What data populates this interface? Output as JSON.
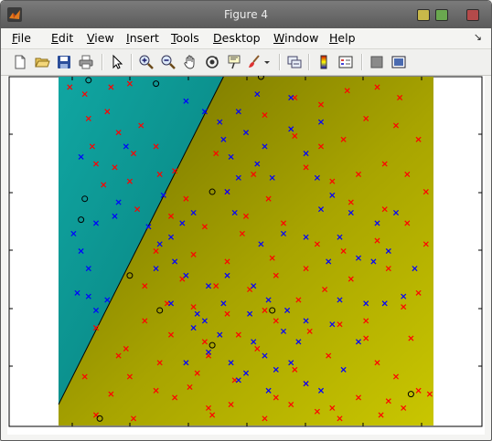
{
  "window": {
    "title": "Figure 4",
    "buttons": [
      "minimize",
      "maximize",
      "close"
    ]
  },
  "menu": {
    "items": [
      {
        "label": "File",
        "mnemonic": "F",
        "rest": "ile"
      },
      {
        "label": "Edit",
        "mnemonic": "E",
        "rest": "dit"
      },
      {
        "label": "View",
        "mnemonic": "V",
        "rest": "iew"
      },
      {
        "label": "Insert",
        "mnemonic": "I",
        "rest": "nsert"
      },
      {
        "label": "Tools",
        "mnemonic": "T",
        "rest": "ools"
      },
      {
        "label": "Desktop",
        "mnemonic": "D",
        "rest": "esktop"
      },
      {
        "label": "Window",
        "mnemonic": "W",
        "rest": "indow"
      },
      {
        "label": "Help",
        "mnemonic": "H",
        "rest": "elp"
      }
    ],
    "dock_icon": "dock-arrow-icon"
  },
  "toolbar": {
    "icons": [
      "new-figure-icon",
      "open-file-icon",
      "save-figure-icon",
      "print-figure-icon",
      "edit-plot-arrow-icon",
      "zoom-in-icon",
      "zoom-out-icon",
      "pan-hand-icon",
      "rotate-3d-icon",
      "data-cursor-icon",
      "brush-icon",
      "brush-dropdown-icon",
      "link-plot-icon",
      "insert-colorbar-icon",
      "insert-legend-icon",
      "hide-plot-tools-icon",
      "show-plot-tools-icon"
    ]
  },
  "colors": {
    "region_class_a": "#0d9e9a",
    "region_class_b": "#a8a400",
    "class_red": "#ff0000",
    "class_blue": "#0000ff",
    "boundary": "#000000"
  },
  "chart_data": {
    "type": "scatter",
    "title": "",
    "xlabel": "",
    "ylabel": "",
    "xlim": [
      0,
      1
    ],
    "ylim": [
      0,
      1
    ],
    "grid": false,
    "tick_labels_shown": false,
    "background": "decision regions: teal (upper-left, class blue) / olive-yellow gradient (lower-right, class red)",
    "decision_boundary": [
      [
        0,
        0.06
      ],
      [
        0.44,
        1.0
      ]
    ],
    "series": [
      {
        "color": "red",
        "marker": "x",
        "points": [
          [
            0.03,
            0.97
          ],
          [
            0.07,
            0.95
          ],
          [
            0.14,
            0.97
          ],
          [
            0.19,
            0.98
          ],
          [
            0.08,
            0.88
          ],
          [
            0.13,
            0.9
          ],
          [
            0.09,
            0.8
          ],
          [
            0.16,
            0.84
          ],
          [
            0.22,
            0.86
          ],
          [
            0.1,
            0.75
          ],
          [
            0.15,
            0.74
          ],
          [
            0.2,
            0.78
          ],
          [
            0.26,
            0.8
          ],
          [
            0.12,
            0.69
          ],
          [
            0.19,
            0.7
          ],
          [
            0.27,
            0.72
          ],
          [
            0.21,
            0.62
          ],
          [
            0.3,
            0.6
          ],
          [
            0.39,
            0.57
          ],
          [
            0.49,
            0.55
          ],
          [
            0.26,
            0.5
          ],
          [
            0.36,
            0.49
          ],
          [
            0.45,
            0.47
          ],
          [
            0.6,
            0.58
          ],
          [
            0.33,
            0.42
          ],
          [
            0.42,
            0.4
          ],
          [
            0.51,
            0.39
          ],
          [
            0.58,
            0.43
          ],
          [
            0.66,
            0.45
          ],
          [
            0.36,
            0.34
          ],
          [
            0.45,
            0.32
          ],
          [
            0.55,
            0.33
          ],
          [
            0.64,
            0.36
          ],
          [
            0.71,
            0.39
          ],
          [
            0.78,
            0.42
          ],
          [
            0.88,
            0.45
          ],
          [
            0.23,
            0.3
          ],
          [
            0.3,
            0.26
          ],
          [
            0.39,
            0.24
          ],
          [
            0.53,
            0.22
          ],
          [
            0.67,
            0.27
          ],
          [
            0.75,
            0.29
          ],
          [
            0.82,
            0.3
          ],
          [
            0.92,
            0.34
          ],
          [
            0.96,
            0.38
          ],
          [
            0.1,
            0.28
          ],
          [
            0.16,
            0.2
          ],
          [
            0.27,
            0.18
          ],
          [
            0.37,
            0.15
          ],
          [
            0.47,
            0.13
          ],
          [
            0.63,
            0.16
          ],
          [
            0.72,
            0.2
          ],
          [
            0.85,
            0.18
          ],
          [
            0.94,
            0.25
          ],
          [
            0.07,
            0.14
          ],
          [
            0.14,
            0.09
          ],
          [
            0.26,
            0.1
          ],
          [
            0.31,
            0.08
          ],
          [
            0.46,
            0.06
          ],
          [
            0.58,
            0.08
          ],
          [
            0.62,
            0.06
          ],
          [
            0.73,
            0.05
          ],
          [
            0.8,
            0.08
          ],
          [
            0.88,
            0.07
          ],
          [
            0.96,
            0.1
          ],
          [
            0.99,
            0.09
          ],
          [
            0.1,
            0.03
          ],
          [
            0.2,
            0.02
          ],
          [
            0.41,
            0.03
          ],
          [
            0.55,
            0.02
          ],
          [
            0.75,
            0.02
          ],
          [
            0.86,
            0.03
          ],
          [
            0.55,
            0.89
          ],
          [
            0.63,
            0.94
          ],
          [
            0.7,
            0.92
          ],
          [
            0.77,
            0.96
          ],
          [
            0.85,
            0.97
          ],
          [
            0.91,
            0.94
          ],
          [
            0.63,
            0.83
          ],
          [
            0.7,
            0.8
          ],
          [
            0.76,
            0.82
          ],
          [
            0.82,
            0.88
          ],
          [
            0.9,
            0.86
          ],
          [
            0.96,
            0.82
          ],
          [
            0.66,
            0.74
          ],
          [
            0.73,
            0.7
          ],
          [
            0.8,
            0.72
          ],
          [
            0.87,
            0.75
          ],
          [
            0.93,
            0.72
          ],
          [
            0.98,
            0.67
          ],
          [
            0.78,
            0.64
          ],
          [
            0.87,
            0.62
          ],
          [
            0.93,
            0.58
          ],
          [
            0.98,
            0.52
          ],
          [
            0.42,
            0.78
          ],
          [
            0.52,
            0.72
          ],
          [
            0.45,
            0.67
          ],
          [
            0.56,
            0.65
          ],
          [
            0.5,
            0.6
          ],
          [
            0.34,
            0.65
          ],
          [
            0.31,
            0.73
          ],
          [
            0.69,
            0.52
          ],
          [
            0.76,
            0.5
          ],
          [
            0.85,
            0.53
          ],
          [
            0.57,
            0.48
          ],
          [
            0.23,
            0.4
          ],
          [
            0.29,
            0.35
          ],
          [
            0.18,
            0.22
          ],
          [
            0.19,
            0.14
          ],
          [
            0.4,
            0.2
          ],
          [
            0.48,
            0.26
          ],
          [
            0.58,
            0.3
          ],
          [
            0.82,
            0.25
          ],
          [
            0.9,
            0.14
          ],
          [
            0.66,
            0.12
          ],
          [
            0.35,
            0.11
          ],
          [
            0.4,
            0.05
          ],
          [
            0.69,
            0.04
          ],
          [
            0.92,
            0.05
          ]
        ]
      },
      {
        "color": "blue",
        "marker": "x",
        "points": [
          [
            0.06,
            0.77
          ],
          [
            0.1,
            0.58
          ],
          [
            0.04,
            0.55
          ],
          [
            0.06,
            0.5
          ],
          [
            0.08,
            0.45
          ],
          [
            0.05,
            0.38
          ],
          [
            0.08,
            0.37
          ],
          [
            0.13,
            0.36
          ],
          [
            0.1,
            0.33
          ],
          [
            0.16,
            0.64
          ],
          [
            0.18,
            0.8
          ],
          [
            0.15,
            0.6
          ],
          [
            0.34,
            0.93
          ],
          [
            0.39,
            0.9
          ],
          [
            0.43,
            0.87
          ],
          [
            0.48,
            0.9
          ],
          [
            0.53,
            0.95
          ],
          [
            0.62,
            0.94
          ],
          [
            0.44,
            0.82
          ],
          [
            0.5,
            0.84
          ],
          [
            0.55,
            0.8
          ],
          [
            0.46,
            0.77
          ],
          [
            0.53,
            0.75
          ],
          [
            0.57,
            0.71
          ],
          [
            0.48,
            0.71
          ],
          [
            0.45,
            0.67
          ],
          [
            0.62,
            0.85
          ],
          [
            0.7,
            0.87
          ],
          [
            0.66,
            0.78
          ],
          [
            0.73,
            0.66
          ],
          [
            0.7,
            0.62
          ],
          [
            0.78,
            0.61
          ],
          [
            0.85,
            0.58
          ],
          [
            0.9,
            0.61
          ],
          [
            0.75,
            0.54
          ],
          [
            0.66,
            0.54
          ],
          [
            0.72,
            0.47
          ],
          [
            0.8,
            0.48
          ],
          [
            0.88,
            0.5
          ],
          [
            0.95,
            0.45
          ],
          [
            0.3,
            0.54
          ],
          [
            0.33,
            0.58
          ],
          [
            0.36,
            0.61
          ],
          [
            0.31,
            0.47
          ],
          [
            0.26,
            0.45
          ],
          [
            0.34,
            0.43
          ],
          [
            0.4,
            0.4
          ],
          [
            0.44,
            0.35
          ],
          [
            0.51,
            0.32
          ],
          [
            0.56,
            0.36
          ],
          [
            0.61,
            0.33
          ],
          [
            0.66,
            0.3
          ],
          [
            0.3,
            0.35
          ],
          [
            0.36,
            0.28
          ],
          [
            0.4,
            0.21
          ],
          [
            0.46,
            0.18
          ],
          [
            0.5,
            0.15
          ],
          [
            0.55,
            0.2
          ],
          [
            0.58,
            0.16
          ],
          [
            0.62,
            0.18
          ],
          [
            0.66,
            0.12
          ],
          [
            0.7,
            0.1
          ],
          [
            0.76,
            0.16
          ],
          [
            0.8,
            0.24
          ],
          [
            0.87,
            0.35
          ],
          [
            0.92,
            0.37
          ],
          [
            0.82,
            0.35
          ],
          [
            0.75,
            0.36
          ],
          [
            0.64,
            0.24
          ],
          [
            0.56,
            0.1
          ],
          [
            0.48,
            0.13
          ],
          [
            0.43,
            0.26
          ],
          [
            0.37,
            0.32
          ],
          [
            0.24,
            0.57
          ],
          [
            0.27,
            0.52
          ],
          [
            0.28,
            0.66
          ],
          [
            0.47,
            0.61
          ],
          [
            0.54,
            0.52
          ],
          [
            0.6,
            0.55
          ],
          [
            0.69,
            0.71
          ],
          [
            0.84,
            0.47
          ],
          [
            0.52,
            0.4
          ],
          [
            0.45,
            0.43
          ],
          [
            0.39,
            0.3
          ],
          [
            0.34,
            0.18
          ],
          [
            0.52,
            0.24
          ],
          [
            0.6,
            0.27
          ],
          [
            0.73,
            0.29
          ]
        ]
      },
      {
        "color": "black",
        "marker": "o",
        "points": [
          [
            0.08,
            0.99
          ],
          [
            0.26,
            0.98
          ],
          [
            0.54,
            1.0
          ],
          [
            0.41,
            0.67
          ],
          [
            0.07,
            0.65
          ],
          [
            0.06,
            0.59
          ],
          [
            0.19,
            0.43
          ],
          [
            0.27,
            0.33
          ],
          [
            0.41,
            0.23
          ],
          [
            0.57,
            0.33
          ],
          [
            0.94,
            0.09
          ],
          [
            0.11,
            0.02
          ]
        ]
      }
    ]
  }
}
